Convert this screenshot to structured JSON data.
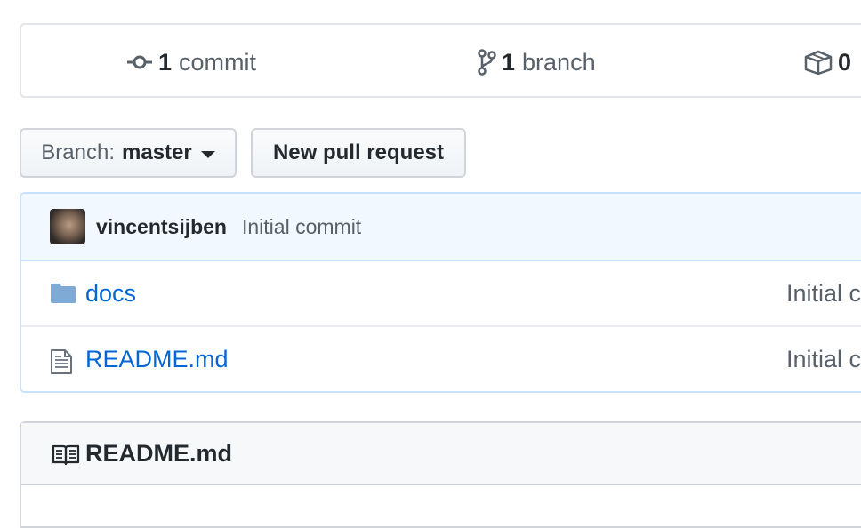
{
  "summary": {
    "commits": {
      "count": "1",
      "label": "commit",
      "icon": "commit-icon"
    },
    "branches": {
      "count": "1",
      "label": "branch",
      "icon": "branch-icon"
    },
    "releases": {
      "count": "0",
      "icon": "package-icon"
    }
  },
  "toolbar": {
    "branch_prefix": "Branch:",
    "branch_name": "master",
    "new_pr_label": "New pull request"
  },
  "commit_tease": {
    "author": "vincentsijben",
    "message": "Initial commit"
  },
  "files": [
    {
      "name": "docs",
      "type": "directory",
      "icon": "folder-icon",
      "message": "Initial commit"
    },
    {
      "name": "README.md",
      "type": "file",
      "icon": "file-icon",
      "message": "Initial commit"
    }
  ],
  "readme": {
    "title": "README.md",
    "icon": "book-icon"
  },
  "colors": {
    "link": "#0366d6",
    "muted": "#586069",
    "text": "#24292e",
    "commit_bg": "#f1f8ff",
    "commit_border": "#c8e1ff",
    "folder": "#79b8ff"
  }
}
